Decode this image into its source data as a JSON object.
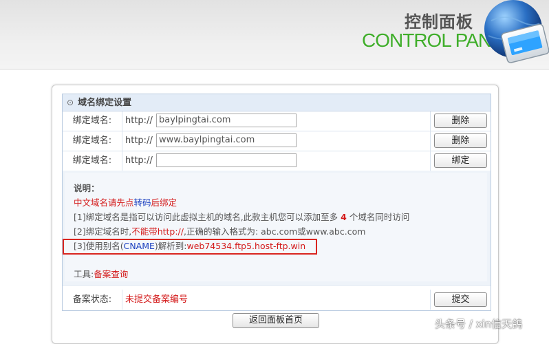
{
  "header": {
    "title_cn": "控制面板",
    "title_en": "CONTROL PANEL",
    "globe_icon": "globe-monitor-icon",
    "colors": {
      "brand_green": "#3fae2a",
      "title_gray": "#555555"
    }
  },
  "section": {
    "title": "域名绑定设置",
    "collapse_icon": "circle-dot-icon"
  },
  "domain_rows": [
    {
      "label": "绑定域名:",
      "prefix": "http://",
      "value": "baylpingtai.com",
      "button": "删除"
    },
    {
      "label": "绑定域名:",
      "prefix": "http://",
      "value": "www.baylpingtai.com",
      "button": "删除"
    },
    {
      "label": "绑定域名:",
      "prefix": "http://",
      "value": "",
      "button": "绑定"
    }
  ],
  "notes": {
    "heading": "说明：",
    "line_cn": {
      "a": "中文域名请先点",
      "link": "转码",
      "b": "后绑定"
    },
    "line1": {
      "a": "[1]绑定域名是指可以访问此虚拟主机的域名,此款主机您可以添加至多 ",
      "count": "4",
      "b": " 个域名同时访问"
    },
    "line2": {
      "a": "[2]绑定域名时,",
      "warn": "不能带http://",
      "b": ",正确的输入格式为: abc.com或www.abc.com"
    },
    "line3": {
      "a": "[3]使用别名(",
      "cname": "CNAME",
      "b": ")解析到:",
      "target": "web74534.ftp5.host-ftp.win"
    },
    "tools": {
      "label": "工具:",
      "link": "备案查询"
    }
  },
  "record": {
    "label": "备案状态:",
    "status": "未提交备案编号",
    "button": "提交"
  },
  "back_button": "返回面板首页",
  "watermark": "头条号 / xin信天鸽"
}
